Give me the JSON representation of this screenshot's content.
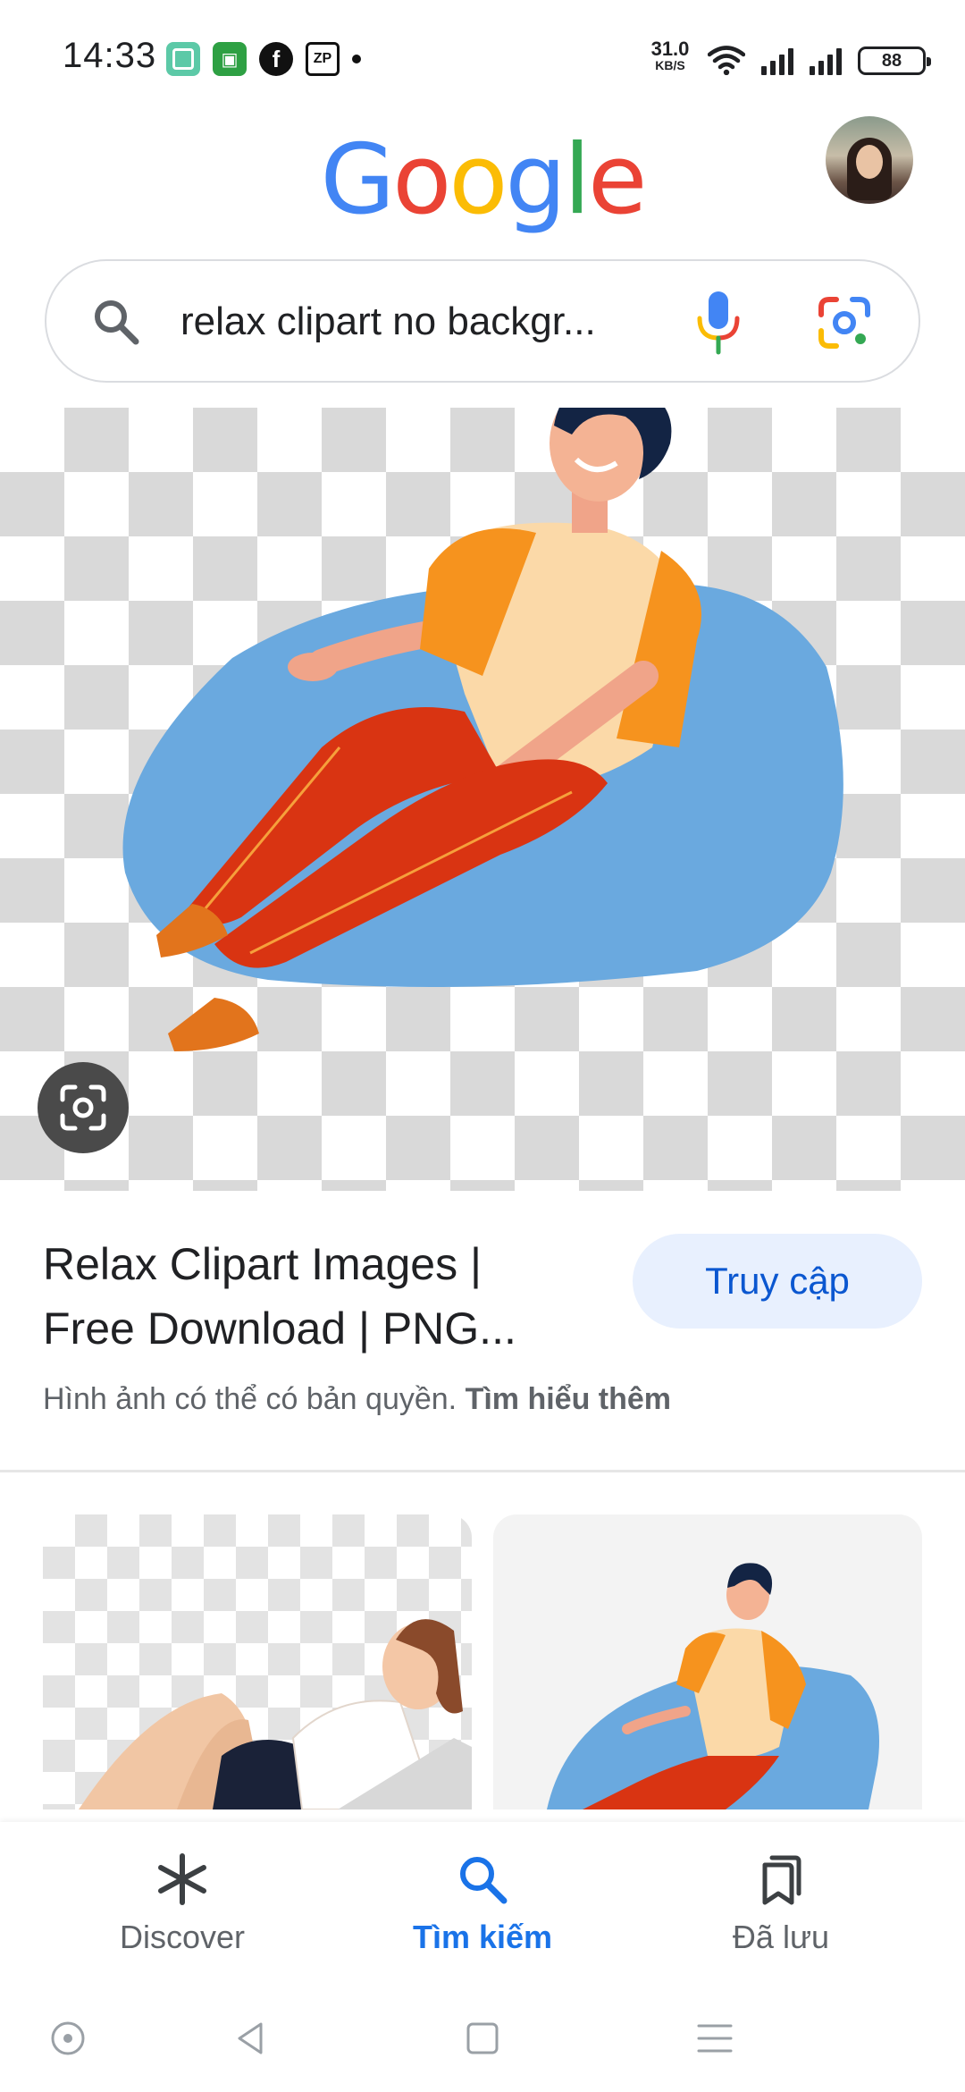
{
  "status_bar": {
    "time": "14:33",
    "notifications": [
      "app-icon",
      "app-icon",
      "facebook-icon",
      "zalo-pay-icon",
      "dot"
    ],
    "net_speed_value": "31.0",
    "net_speed_unit": "KB/S",
    "battery": "88"
  },
  "header": {
    "logo_letters": [
      "G",
      "o",
      "o",
      "g",
      "l",
      "e"
    ]
  },
  "search": {
    "query": "relax clipart no backgr..."
  },
  "result": {
    "title_line1": "Relax Clipart Images |",
    "title_line2": "Free Download | PNG...",
    "visit_button": "Truy cập",
    "copyright_text": "Hình ảnh có thể có bản quyền.",
    "learn_more": "Tìm hiểu thêm"
  },
  "bottom_nav": {
    "items": [
      {
        "label": "Discover",
        "icon": "asterisk-icon"
      },
      {
        "label": "Tìm kiếm",
        "icon": "search-icon",
        "active": true
      },
      {
        "label": "Đã lưu",
        "icon": "bookmarks-icon"
      }
    ]
  },
  "colors": {
    "accent": "#1a73e8",
    "visit_button_bg": "#e8f0fe",
    "visit_button_text": "#0b57d0"
  }
}
